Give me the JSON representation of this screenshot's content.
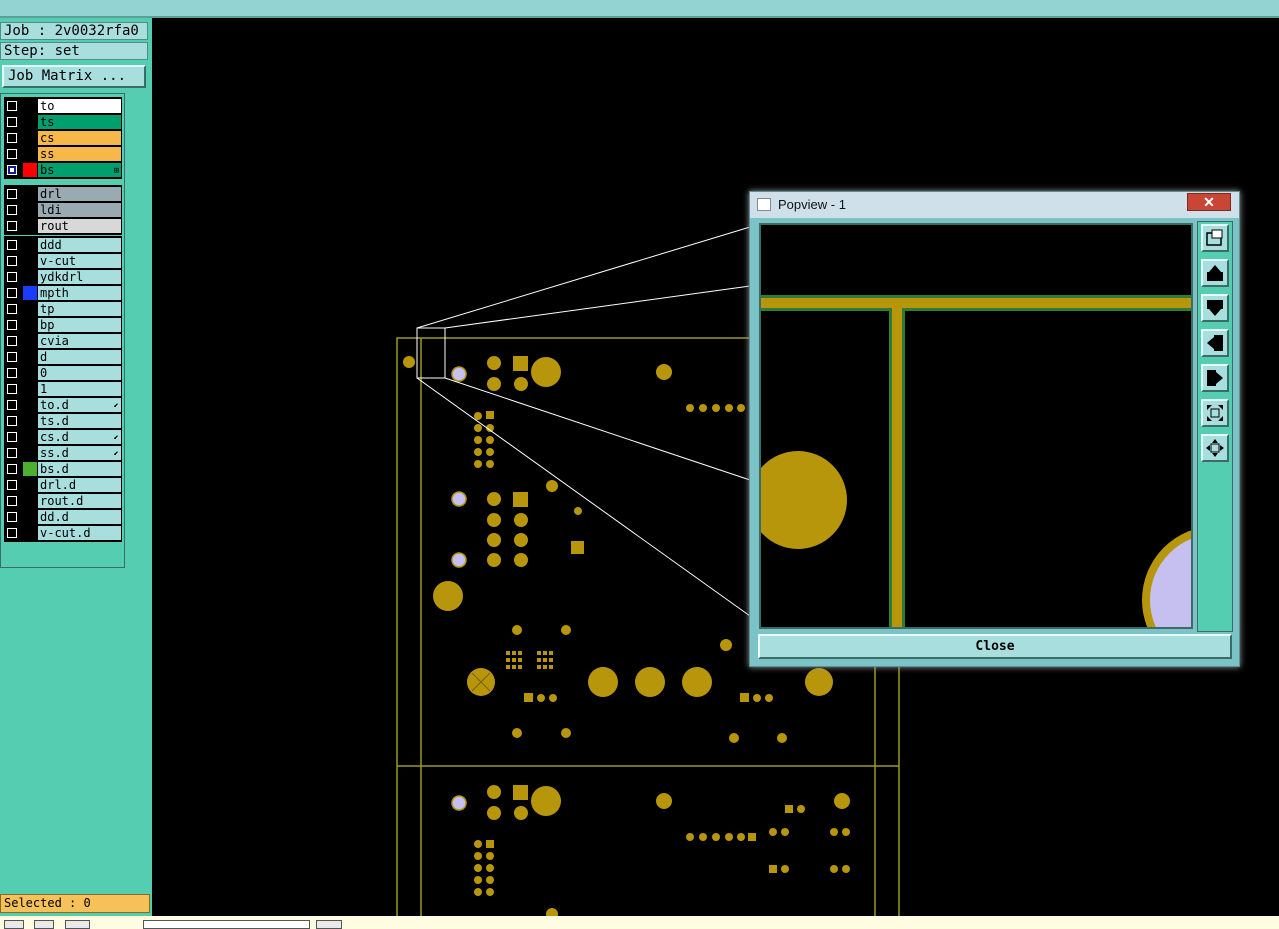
{
  "job_label": "Job : 2v0032rfa0",
  "step_label": "Step: set",
  "job_matrix_button": "Job Matrix ...",
  "selected_label": "Selected : 0",
  "colors": {
    "panel": "#55cdb0",
    "copper": "#b8960c",
    "board_outline": "#9a9a1e",
    "pad_violet": "#c5c0f0"
  },
  "layers": [
    {
      "name": "to",
      "color": "#ffffff",
      "swatch": "",
      "active": false
    },
    {
      "name": "ts",
      "color": "#00a06e",
      "swatch": "",
      "active": false
    },
    {
      "name": "cs",
      "color": "#f7b84a",
      "swatch": "",
      "active": false
    },
    {
      "name": "ss",
      "color": "#f7b84a",
      "swatch": "",
      "active": false
    },
    {
      "name": "bs",
      "color": "#00a06e",
      "swatch": "#ff0000",
      "active": true,
      "mark": "⊞"
    },
    {
      "name": "drl",
      "color": "#9aaab2",
      "swatch": "",
      "active": false
    },
    {
      "name": "ldi",
      "color": "#9aaab2",
      "swatch": "",
      "active": false
    },
    {
      "name": "rout",
      "color": "#d8d8d8",
      "swatch": "",
      "active": false
    },
    {
      "name": "ddd",
      "color": "#a8dede",
      "swatch": "",
      "active": false
    },
    {
      "name": "v-cut",
      "color": "#a8dede",
      "swatch": "",
      "active": false
    },
    {
      "name": "ydkdrl",
      "color": "#a8dede",
      "swatch": "",
      "active": false
    },
    {
      "name": "mpth",
      "color": "#a8dede",
      "swatch": "#1a3cff",
      "active": false
    },
    {
      "name": "tp",
      "color": "#a8dede",
      "swatch": "",
      "active": false
    },
    {
      "name": "bp",
      "color": "#a8dede",
      "swatch": "",
      "active": false
    },
    {
      "name": "cvia",
      "color": "#a8dede",
      "swatch": "",
      "active": false
    },
    {
      "name": "d",
      "color": "#a8dede",
      "swatch": "",
      "active": false
    },
    {
      "name": "0",
      "color": "#a8dede",
      "swatch": "",
      "active": false
    },
    {
      "name": "1",
      "color": "#a8dede",
      "swatch": "",
      "active": false
    },
    {
      "name": "to.d",
      "color": "#a8dede",
      "swatch": "",
      "active": false,
      "mark": "⬋"
    },
    {
      "name": "ts.d",
      "color": "#a8dede",
      "swatch": "",
      "active": false
    },
    {
      "name": "cs.d",
      "color": "#a8dede",
      "swatch": "",
      "active": false,
      "mark": "⬋"
    },
    {
      "name": "ss.d",
      "color": "#a8dede",
      "swatch": "",
      "active": false,
      "mark": "⬋"
    },
    {
      "name": "bs.d",
      "color": "#a8dede",
      "swatch": "#4caf30",
      "active": false
    },
    {
      "name": "drl.d",
      "color": "#a8dede",
      "swatch": "",
      "active": false
    },
    {
      "name": "rout.d",
      "color": "#a8dede",
      "swatch": "",
      "active": false
    },
    {
      "name": "dd.d",
      "color": "#a8dede",
      "swatch": "",
      "active": false
    },
    {
      "name": "v-cut.d",
      "color": "#a8dede",
      "swatch": "",
      "active": false
    }
  ],
  "popview": {
    "title": "Popview - 1",
    "close_x": "✕",
    "close_button": "Close",
    "tools": [
      "fit-window-icon",
      "move-up-icon",
      "move-down-icon",
      "move-left-icon",
      "move-right-icon",
      "zoom-out-icon",
      "zoom-fit-icon"
    ]
  }
}
